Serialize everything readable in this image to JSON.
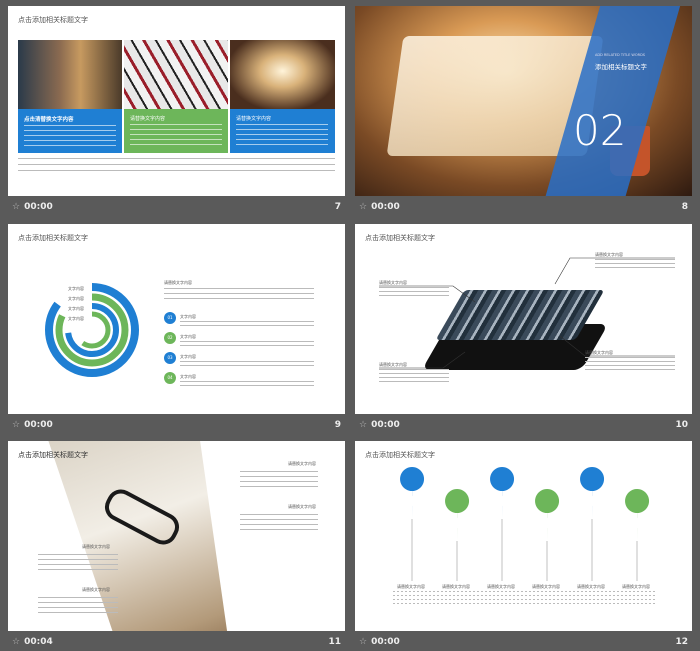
{
  "slides": [
    {
      "number": "7",
      "time": "00:00",
      "title": "点击添加相关标题文字",
      "cards": [
        {
          "heading": "点击清替换文字内容",
          "color": "#1f7fd3"
        },
        {
          "heading": "请替换文字内容",
          "color": "#6db65a"
        },
        {
          "heading": "请替换文字内容",
          "color": "#1f7fd3"
        }
      ]
    },
    {
      "number": "8",
      "time": "00:00",
      "kicker": "ADD RELATED TITLE WORDS",
      "title": "添加相关标题文字",
      "big": "02"
    },
    {
      "number": "9",
      "time": "00:00",
      "title": "点击添加相关标题文字",
      "ring_labels": [
        "文字内容",
        "文字内容",
        "文字内容",
        "文字内容"
      ],
      "side_heading": "请替换文字内容",
      "items": [
        {
          "label": "文字内容",
          "badge": "01"
        },
        {
          "label": "文字内容",
          "badge": "02"
        },
        {
          "label": "文字内容",
          "badge": "03"
        },
        {
          "label": "文字内容",
          "badge": "04"
        }
      ]
    },
    {
      "number": "10",
      "time": "00:00",
      "title": "点击添加相关标题文字",
      "callouts": [
        "请替换文字内容",
        "请替换文字内容",
        "请替换文字内容",
        "请替换文字内容"
      ]
    },
    {
      "number": "11",
      "time": "00:04",
      "title": "点击添加相关标题文字",
      "labels": [
        "请替换文字内容",
        "请替换文字内容",
        "请替换文字内容",
        "请替换文字内容"
      ]
    },
    {
      "number": "12",
      "time": "00:00",
      "title": "点击添加相关标题文字",
      "pins": [
        "请替换文字内容",
        "请替换文字内容",
        "请替换文字内容",
        "请替换文字内容",
        "请替换文字内容",
        "请替换文字内容"
      ]
    }
  ],
  "colors": {
    "blue": "#1f7fd3",
    "green": "#6db65a",
    "bg": "#5a5a5a"
  }
}
